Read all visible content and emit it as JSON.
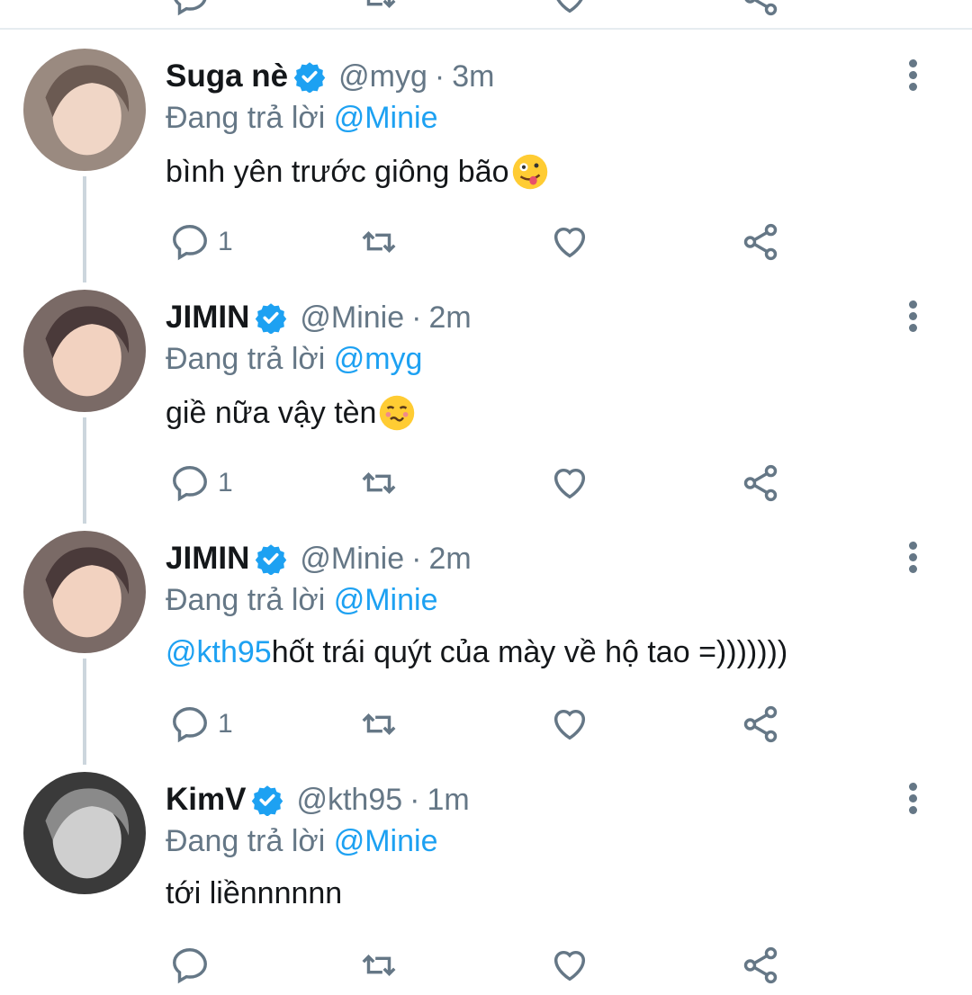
{
  "colors": {
    "accent": "#1da1f2",
    "secondary_text": "#657786",
    "primary_text": "#14171a",
    "divider": "#e6ecf0"
  },
  "reply_prefix": "Đang trả lời",
  "tweets": [
    {
      "name": "Suga nè",
      "handle": "@myg",
      "separator": "·",
      "time": "3m",
      "reply_to": "@Minie",
      "mention": "",
      "text": "bình yên trước giông bão",
      "emoji": "zany-face-emoji",
      "reply_count": "1",
      "avatar": "avatar-photo"
    },
    {
      "name": "JIMIN",
      "handle": "@Minie",
      "separator": "·",
      "time": "2m",
      "reply_to": "@myg",
      "mention": "",
      "text": "giề nữa vậy tèn",
      "emoji": "woozy-face-emoji",
      "reply_count": "1",
      "avatar": "avatar-photo"
    },
    {
      "name": "JIMIN",
      "handle": "@Minie",
      "separator": "·",
      "time": "2m",
      "reply_to": "@Minie",
      "mention": "@kth95",
      "text": " hốt trái quýt của mày về hộ tao =)))))))",
      "emoji": "",
      "reply_count": "1",
      "avatar": "avatar-photo"
    },
    {
      "name": "KimV",
      "handle": "@kth95",
      "separator": "·",
      "time": "1m",
      "reply_to": "@Minie",
      "mention": "",
      "text": "tới liềnnnnnn",
      "emoji": "",
      "reply_count": "",
      "avatar": "avatar-photo"
    }
  ],
  "icons": [
    "reply-icon",
    "retweet-icon",
    "like-icon",
    "share-icon",
    "more-options-icon",
    "verified-badge-icon"
  ]
}
